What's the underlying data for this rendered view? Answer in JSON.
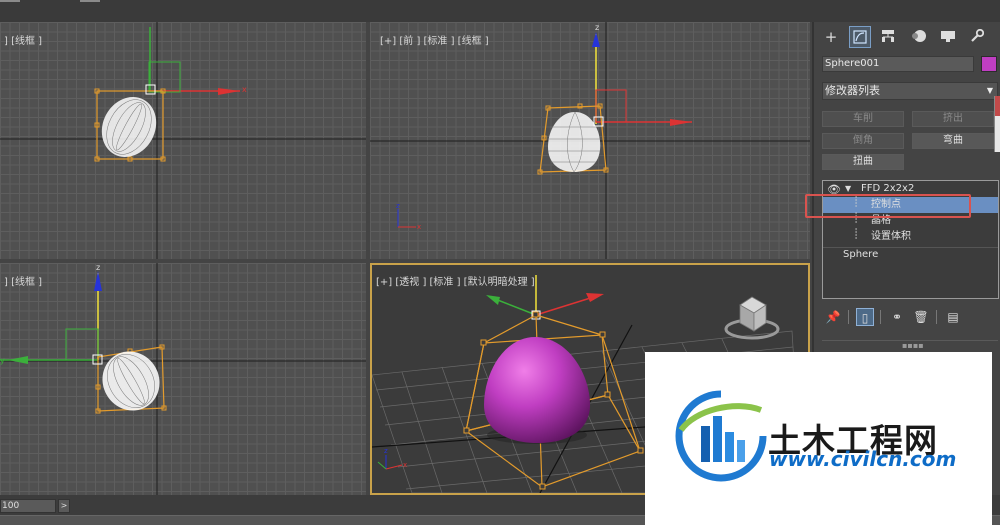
{
  "viewports": {
    "top": {
      "label": "] [线框 ]"
    },
    "front": {
      "label": "[+] [前 ] [标准 ] [线框 ]"
    },
    "left": {
      "label": "] [线框 ]"
    },
    "perspective": {
      "label": "[+] [透视 ] [标准 ] [默认明暗处理 ]"
    }
  },
  "axis_labels": {
    "x": "x",
    "y": "y",
    "z": "z"
  },
  "command_panel": {
    "tabs": [
      {
        "icon": "create-icon",
        "symbol": "+"
      },
      {
        "icon": "modify-icon",
        "active": true
      },
      {
        "icon": "hierarchy-icon"
      },
      {
        "icon": "motion-icon"
      },
      {
        "icon": "display-icon"
      },
      {
        "icon": "utilities-icon"
      }
    ],
    "object_name": "Sphere001",
    "object_color": "#c03ec2",
    "modifier_list": "修改器列表",
    "modifier_buttons": [
      {
        "label": "车削",
        "enabled": false
      },
      {
        "label": "挤出",
        "enabled": false
      },
      {
        "label": "倒角",
        "enabled": false
      },
      {
        "label": "弯曲",
        "enabled": true
      },
      {
        "label": "扭曲",
        "enabled": true
      }
    ],
    "stack": {
      "modifier": "FFD 2x2x2",
      "sub_items": [
        "控制点",
        "晶格",
        "设置体积"
      ],
      "selected_sub_item": "控制点",
      "base_object": "Sphere"
    }
  },
  "timeline": {
    "frame_value": "100",
    "next_symbol": ">"
  },
  "watermark": {
    "title": "土木工程网",
    "url": "www.civilcn.com"
  },
  "colors": {
    "accent": "#6a8fc2",
    "viewport_active_border": "#c9a24a",
    "lattice": "#e39b2c",
    "annotation": "#d9534f"
  }
}
